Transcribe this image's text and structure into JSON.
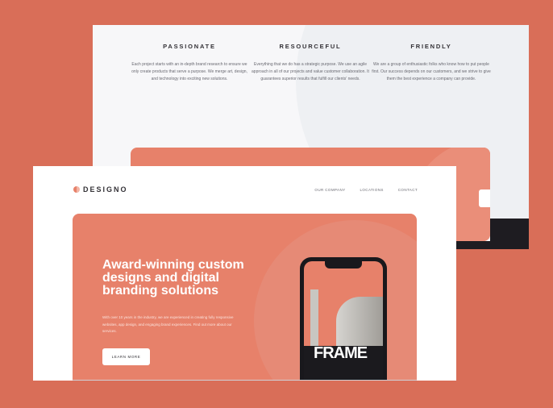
{
  "features": [
    {
      "title": "PASSIONATE",
      "text": "Each project starts with an in-depth brand research to ensure we only create products that serve a purpose. We merge art, design, and technology into exciting new solutions."
    },
    {
      "title": "RESOURCEFUL",
      "text": "Everything that we do has a strategic purpose. We use an agile approach in all of our projects and value customer collaboration. It guarantees superior results that fulfill our clients' needs."
    },
    {
      "title": "FRIENDLY",
      "text": "We are a group of enthusiastic folks who know how to put people first. Our success depends on our customers, and we strive to give them the best experience a company can provide."
    }
  ],
  "header": {
    "logo": "DESIGNO",
    "nav": [
      "OUR COMPANY",
      "LOCATIONS",
      "CONTACT"
    ]
  },
  "hero": {
    "title": "Award-winning custom designs and digital branding solutions",
    "text": "With over 10 years in the industry, we are experienced in creating fully responsive websites, app design, and engaging brand experiences. Find out more about our services.",
    "button": "LEARN MORE"
  },
  "phone": {
    "screen_text": "FRAME"
  },
  "colors": {
    "background": "#d96e58",
    "accent": "#e7816a",
    "dark": "#1e1c21",
    "light": "#f7f7f9"
  }
}
